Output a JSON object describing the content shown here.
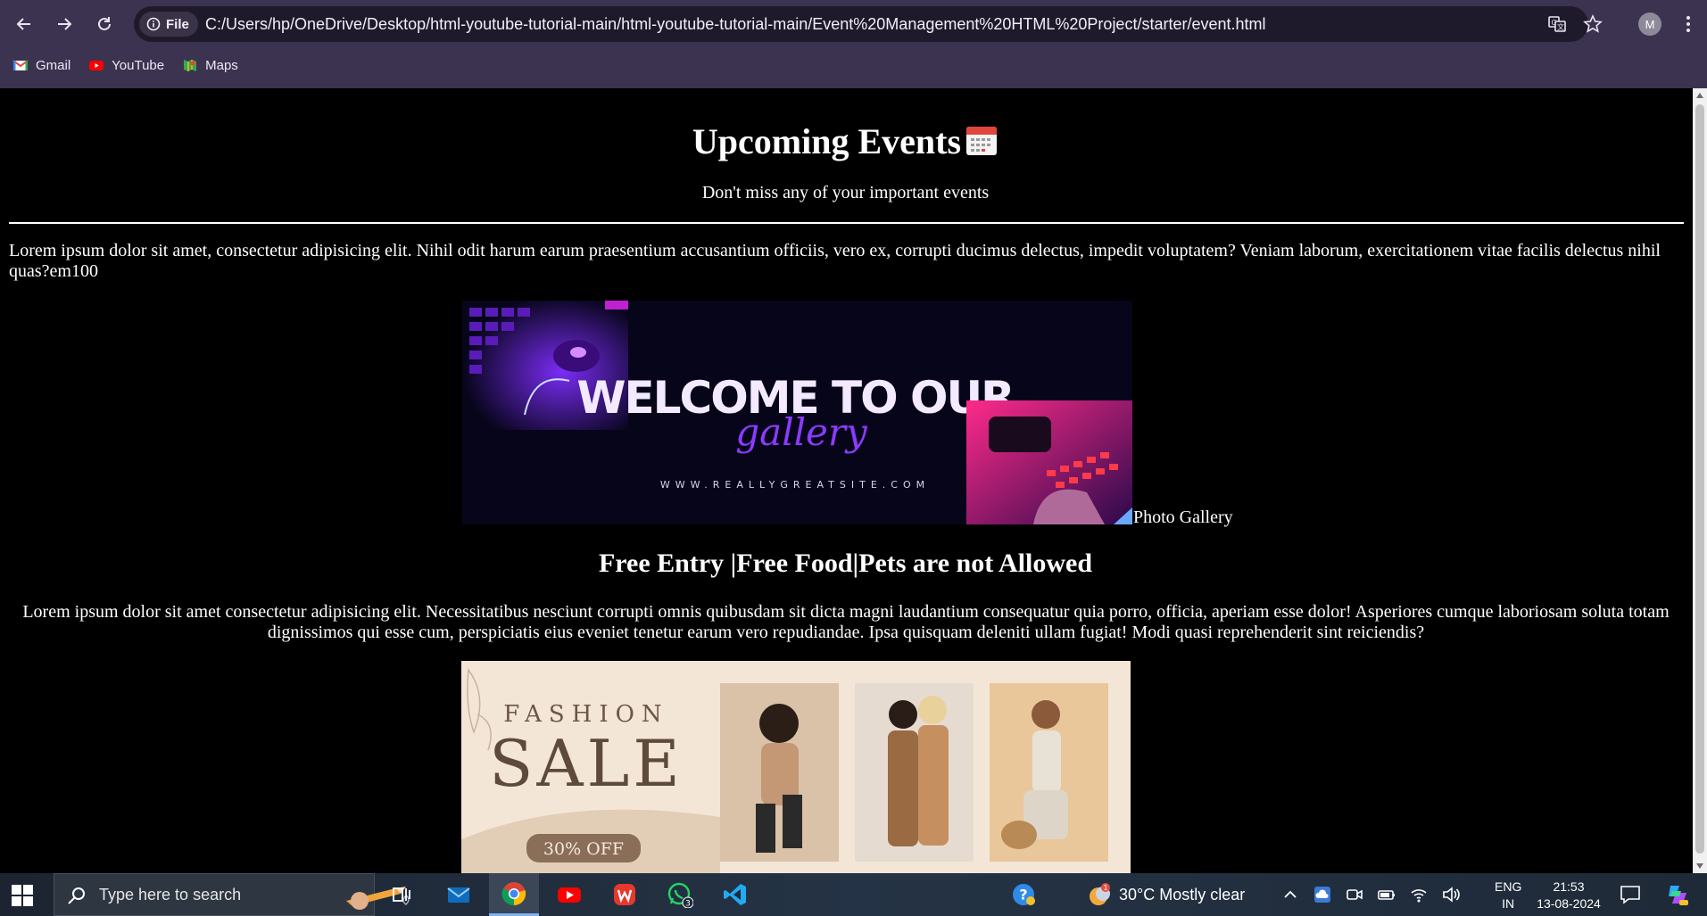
{
  "browser": {
    "site_chip_label": "File",
    "url": "C:/Users/hp/OneDrive/Desktop/html-youtube-tutorial-main/html-youtube-tutorial-main/Event%20Management%20HTML%20Project/starter/event.html",
    "profile_initial": "M",
    "bookmarks": [
      {
        "label": "Gmail",
        "icon": "gmail-icon"
      },
      {
        "label": "YouTube",
        "icon": "youtube-icon"
      },
      {
        "label": "Maps",
        "icon": "maps-icon"
      }
    ]
  },
  "page": {
    "title": "Upcoming Events",
    "title_icon": "calendar-icon",
    "subtitle": "Don't miss any of your important events",
    "intro": "Lorem ipsum dolor sit amet, consectetur adipisicing elit. Nihil odit harum earum praesentium accusantium officiis, vero ex, corrupti ducimus delectus, impedit voluptatem? Veniam laborum, exercitationem vitae facilis delectus nihil quas?em100",
    "gallery_banner": {
      "headline": "WELCOME TO OUR",
      "script_word": "gallery",
      "site": "WWW.REALLYGREATSITE.COM"
    },
    "gallery_caption": "Photo Gallery",
    "features_heading": "Free Entry |Free Food|Pets are not Allowed",
    "description": "Lorem ipsum dolor sit amet consectetur adipisicing elit. Necessitatibus nesciunt corrupti omnis quibusdam sit dicta magni laudantium consequatur quia porro, officia, aperiam esse dolor! Asperiores cumque laboriosam soluta totam dignissimos qui esse cum, perspiciatis eius eveniet tenetur earum vero repudiandae. Ipsa quisquam deleniti ullam fugiat! Modi quasi reprehenderit sint reiciendis?",
    "fashion_banner": {
      "line1": "FASHION",
      "line2": "SALE",
      "badge": "30% OFF"
    }
  },
  "taskbar": {
    "search_placeholder": "Type here to search",
    "apps": [
      "task-view",
      "mail",
      "chrome",
      "youtube",
      "wps-office",
      "whatsapp",
      "vs-code"
    ],
    "whatsapp_badge": "3",
    "weather_badge": "1",
    "weather": "30°C  Mostly clear",
    "lang_line1": "ENG",
    "lang_line2": "IN",
    "time": "21:53",
    "date": "13-08-2024"
  },
  "colors": {
    "chrome_bg": "#3c3350",
    "omnibox_bg": "#1f1a2b",
    "page_bg": "#000000",
    "taskbar_bg": "#1b2430"
  }
}
